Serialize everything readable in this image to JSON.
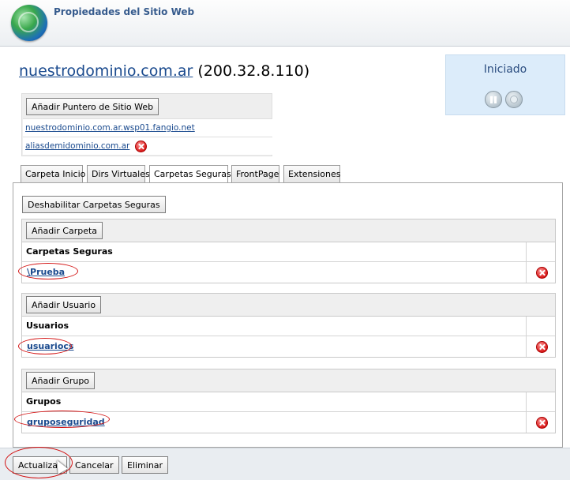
{
  "header": {
    "title": "Propiedades del Sitio Web"
  },
  "site": {
    "domain": "nuestrodominio.com.ar",
    "ip": "(200.32.8.110)"
  },
  "status": {
    "label": "Iniciado"
  },
  "aliases": {
    "add_button": "Añadir Puntero de Sitio Web",
    "items": [
      "nuestrodominio.com.ar.wsp01.fangio.net",
      "aliasdemidominio.com.ar"
    ]
  },
  "tabs": [
    "Carpeta Inicio",
    "Dirs Virtuales",
    "Carpetas Seguras",
    "FrontPage",
    "Extensiones"
  ],
  "active_tab": "Carpetas Seguras",
  "main": {
    "disable_button": "Deshabilitar Carpetas Seguras",
    "folders": {
      "add_button": "Añadir Carpeta",
      "header": "Carpetas Seguras",
      "items": [
        "\\Prueba"
      ]
    },
    "users": {
      "add_button": "Añadir Usuario",
      "header": "Usuarios",
      "items": [
        "usuariocs"
      ]
    },
    "groups": {
      "add_button": "Añadir Grupo",
      "header": "Grupos",
      "items": [
        "gruposeguridad"
      ]
    }
  },
  "footer": {
    "update_button": "Actualizar",
    "cancel_button": "Cancelar",
    "delete_button": "Eliminar"
  },
  "colors": {
    "link": "#1a4a8e",
    "header_title": "#365b8d",
    "status_bg": "#dcecfa",
    "highlight": "#d31313"
  },
  "icons": [
    "globe-icon",
    "pause-icon",
    "stop-icon",
    "delete-icon",
    "mouse-cursor-icon"
  ]
}
